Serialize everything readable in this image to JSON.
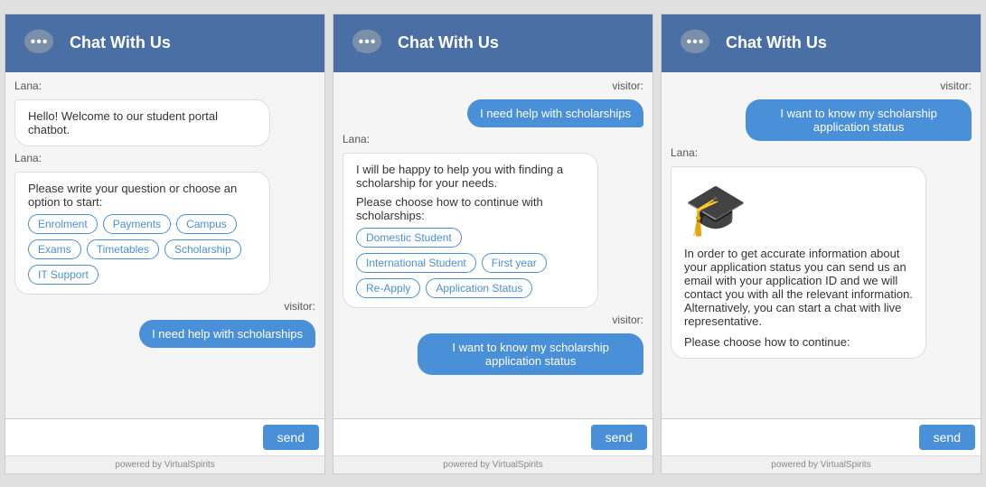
{
  "widgets": [
    {
      "id": "widget-1",
      "header": {
        "title": "Chat With Us"
      },
      "messages": [
        {
          "type": "lana",
          "text": "Hello! Welcome to our student portal chatbot."
        },
        {
          "type": "lana",
          "text": "Please write your question or choose an option to start:",
          "chips": [
            "Enrolment",
            "Payments",
            "Campus",
            "Exams",
            "Timetables",
            "Scholarship",
            "IT Support"
          ]
        },
        {
          "type": "visitor",
          "text": "I need help with scholarships"
        }
      ],
      "input_placeholder": "",
      "send_label": "send",
      "powered_by": "powered by VirtualSpirits"
    },
    {
      "id": "widget-2",
      "header": {
        "title": "Chat With Us"
      },
      "messages": [
        {
          "type": "visitor",
          "text": "I need help with scholarships"
        },
        {
          "type": "lana",
          "text": "I will be happy to help you with finding a scholarship for your needs.\nPlease choose how to continue with scholarships:",
          "chips": [
            "Domestic Student",
            "International Student",
            "First year",
            "Re-Apply",
            "Application Status"
          ]
        },
        {
          "type": "visitor",
          "text": "I want to know my scholarship application status"
        }
      ],
      "input_placeholder": "",
      "send_label": "send",
      "powered_by": "powered by VirtualSpirits"
    },
    {
      "id": "widget-3",
      "header": {
        "title": "Chat With Us"
      },
      "messages": [
        {
          "type": "visitor",
          "text": "I want to know my scholarship application status"
        },
        {
          "type": "lana",
          "has_cap": true,
          "text": "In order to get accurate information about your application status you can send us an email with your application ID and we will contact you with all the relevant information. Alternatively, you can start a chat with live representative.",
          "extra": "Please choose how to continue:"
        }
      ],
      "input_placeholder": "",
      "send_label": "send",
      "powered_by": "powered by VirtualSpirits"
    }
  ]
}
